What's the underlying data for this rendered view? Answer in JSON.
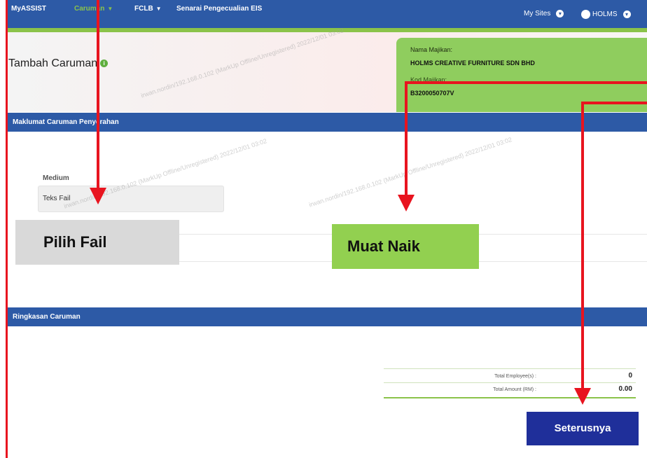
{
  "nav": {
    "brand": "MyASSIST",
    "menu1": "Caruman",
    "menu2": "FCLB",
    "menu3": "Senarai Pengecualian EIS",
    "my_sites": "My Sites",
    "user": "HOLMS"
  },
  "page": {
    "title": "Tambah Caruman"
  },
  "employer": {
    "name_label": "Nama Majikan:",
    "name_value": "HOLMS CREATIVE FURNITURE SDN BHD",
    "code_label": "Kod Majikan:",
    "code_value": "B3200050707V"
  },
  "sections": {
    "submission": "Maklumat Caruman Penyerahan",
    "summary": "Ringkasan Caruman"
  },
  "form": {
    "medium_label": "Medium",
    "medium_value": "Teks Fail"
  },
  "buttons": {
    "choose_file": "Pilih Fail",
    "upload": "Muat Naik",
    "next": "Seterusnya"
  },
  "summary": {
    "employees_label": "Total Employee(s) :",
    "employees_value": "0",
    "amount_label": "Total Amount (RM) :",
    "amount_value": "0.00"
  },
  "watermark": "irwan.nordin/192.168.0.102 (MarkUp Offline/Unregistered) 2022/12/01 03:02",
  "colors": {
    "nav_blue": "#2d5aa6",
    "accent_green": "#8bc34a",
    "arrow_red": "#e8141f",
    "next_button": "#1f2f9a"
  }
}
